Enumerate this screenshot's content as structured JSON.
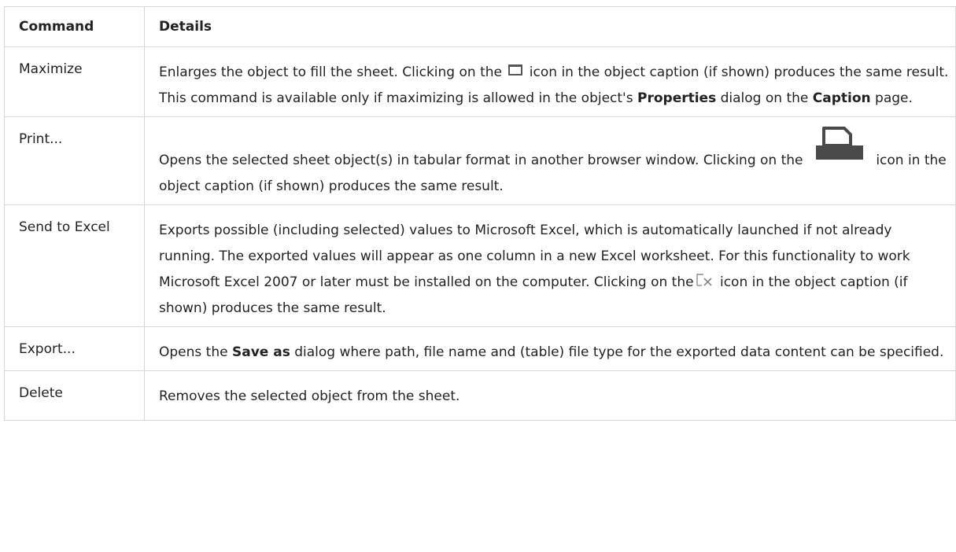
{
  "table": {
    "headers": {
      "command": "Command",
      "details": "Details"
    },
    "rows": {
      "maximize": {
        "command": "Maximize",
        "d1": "Enlarges the object to fill the sheet. Clicking on the",
        "d2": "icon in the object caption (if shown) produces the same result. This command is available only if maximizing is allowed in the object's",
        "b1": "Properties",
        "d3": "dialog on the",
        "b2": "Caption",
        "d4": "page."
      },
      "print": {
        "command": "Print...",
        "d1": "Opens the selected sheet object(s) in tabular format in another browser window. Clicking on the",
        "d2": "icon in the object caption (if shown) produces the same result."
      },
      "send_to_excel": {
        "command": "Send to Excel",
        "d1": "Exports possible (including selected) values to Microsoft Excel, which is automatically launched if not already running. The exported values will appear as one column in a new Excel worksheet. For this functionality to work Microsoft Excel 2007 or later must be installed on the computer. Clicking on the",
        "d2": "icon in the object caption (if shown) produces the same result."
      },
      "export": {
        "command": "Export...",
        "d1": "Opens the",
        "b1": "Save as",
        "d2": "dialog where path, file name and (table) file type for the exported data content can be specified."
      },
      "delete": {
        "command": "Delete",
        "d1": "Removes the selected object from the sheet."
      }
    },
    "icons": {
      "maximize": "maximize-icon",
      "print": "print-icon",
      "excel": "send-to-excel-icon"
    }
  }
}
